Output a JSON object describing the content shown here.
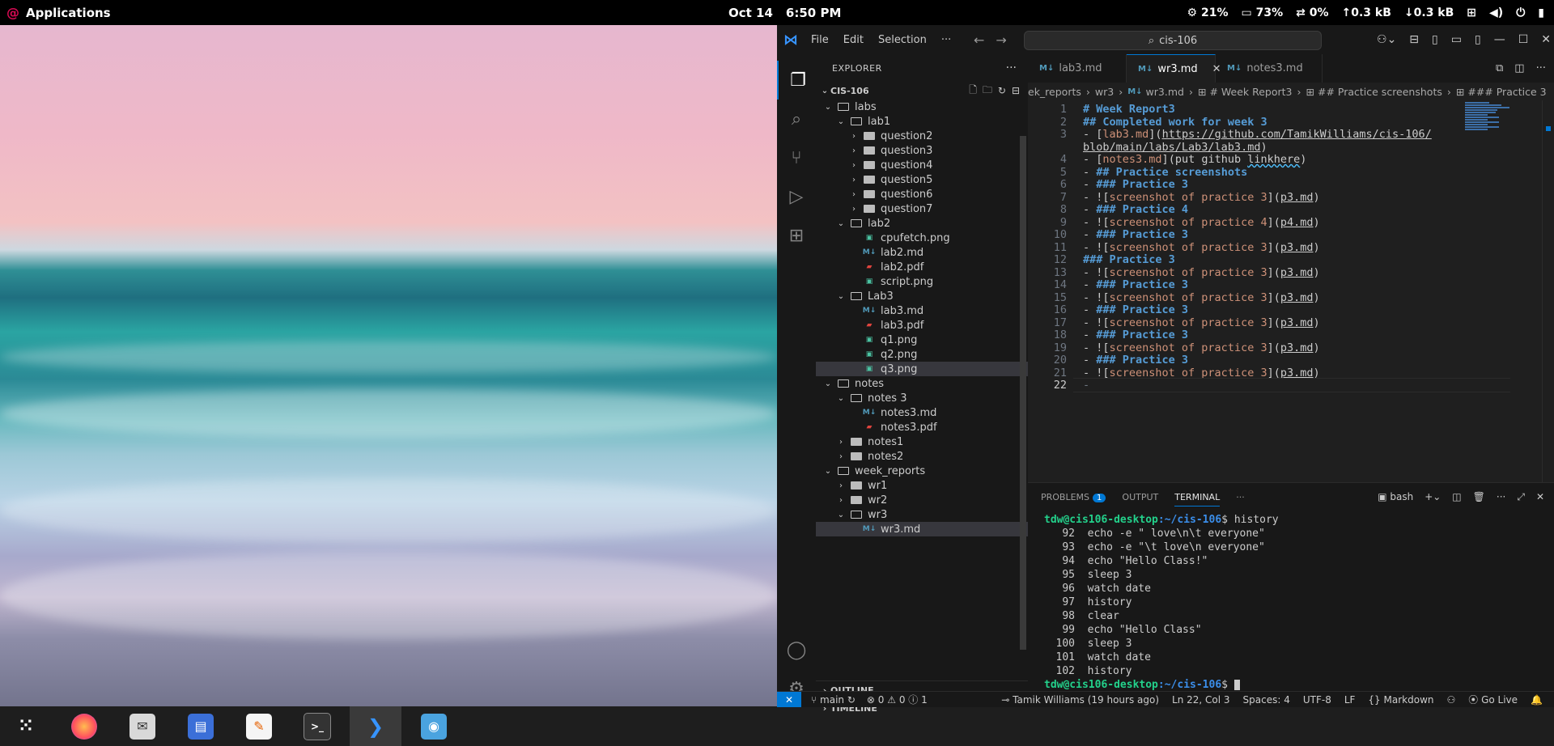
{
  "topbar": {
    "apps_label": "Applications",
    "date": "Oct 14",
    "time": "6:50 PM",
    "cpu": "21%",
    "mem": "73%",
    "swap": "0%",
    "net_up": "↑0.3 kB",
    "net_down": "↓0.3 kB"
  },
  "vscode": {
    "menus": [
      "File",
      "Edit",
      "Selection",
      "···"
    ],
    "search": "cis-106",
    "explorer_title": "EXPLORER",
    "root_folder": "CIS-106",
    "tree": [
      {
        "label": "labs",
        "indent": 1,
        "kind": "folder",
        "open": true
      },
      {
        "label": "lab1",
        "indent": 2,
        "kind": "folder",
        "open": true
      },
      {
        "label": "question2",
        "indent": 3,
        "kind": "folder",
        "open": false
      },
      {
        "label": "question3",
        "indent": 3,
        "kind": "folder",
        "open": false
      },
      {
        "label": "question4",
        "indent": 3,
        "kind": "folder",
        "open": false
      },
      {
        "label": "question5",
        "indent": 3,
        "kind": "folder",
        "open": false
      },
      {
        "label": "question6",
        "indent": 3,
        "kind": "folder",
        "open": false
      },
      {
        "label": "question7",
        "indent": 3,
        "kind": "folder",
        "open": false
      },
      {
        "label": "lab2",
        "indent": 2,
        "kind": "folder",
        "open": true
      },
      {
        "label": "cpufetch.png",
        "indent": 3,
        "kind": "png"
      },
      {
        "label": "lab2.md",
        "indent": 3,
        "kind": "md"
      },
      {
        "label": "lab2.pdf",
        "indent": 3,
        "kind": "pdf"
      },
      {
        "label": "script.png",
        "indent": 3,
        "kind": "png"
      },
      {
        "label": "Lab3",
        "indent": 2,
        "kind": "folder",
        "open": true
      },
      {
        "label": "lab3.md",
        "indent": 3,
        "kind": "md"
      },
      {
        "label": "lab3.pdf",
        "indent": 3,
        "kind": "pdf"
      },
      {
        "label": "q1.png",
        "indent": 3,
        "kind": "png"
      },
      {
        "label": "q2.png",
        "indent": 3,
        "kind": "png"
      },
      {
        "label": "q3.png",
        "indent": 3,
        "kind": "png",
        "hover": true
      },
      {
        "label": "notes",
        "indent": 1,
        "kind": "folder",
        "open": true
      },
      {
        "label": "notes 3",
        "indent": 2,
        "kind": "folder",
        "open": true
      },
      {
        "label": "notes3.md",
        "indent": 3,
        "kind": "md"
      },
      {
        "label": "notes3.pdf",
        "indent": 3,
        "kind": "pdf"
      },
      {
        "label": "notes1",
        "indent": 2,
        "kind": "folder",
        "open": false
      },
      {
        "label": "notes2",
        "indent": 2,
        "kind": "folder",
        "open": false
      },
      {
        "label": "week_reports",
        "indent": 1,
        "kind": "folder",
        "open": true
      },
      {
        "label": "wr1",
        "indent": 2,
        "kind": "folder",
        "open": false
      },
      {
        "label": "wr2",
        "indent": 2,
        "kind": "folder",
        "open": false
      },
      {
        "label": "wr3",
        "indent": 2,
        "kind": "folder",
        "open": true
      },
      {
        "label": "wr3.md",
        "indent": 3,
        "kind": "md",
        "selected": true
      }
    ],
    "outline_label": "OUTLINE",
    "timeline_label": "TIMELINE",
    "tabs": [
      {
        "label": "lab3.md",
        "active": false
      },
      {
        "label": "wr3.md",
        "active": true
      },
      {
        "label": "notes3.md",
        "active": false
      }
    ],
    "breadcrumb": [
      "ek_reports",
      "wr3",
      "wr3.md",
      "# Week Report3",
      "## Practice screenshots",
      "### Practice 3"
    ],
    "code_lines": [
      {
        "n": "1",
        "kind": "h",
        "text": "# Week Report3"
      },
      {
        "n": "2",
        "kind": "h",
        "text": "## Completed work for week 3"
      },
      {
        "n": "3",
        "kind": "link",
        "label": "lab3.md",
        "url": "https://github.com/TamikWilliams/cis-106/",
        "url2": "blob/main/labs/Lab3/lab3.md"
      },
      {
        "n": "4",
        "kind": "link2",
        "label": "notes3.md",
        "pre": "(put github ",
        "sq": "linkhere",
        "post": ")"
      },
      {
        "n": "5",
        "kind": "lh",
        "text": "## Practice screenshots"
      },
      {
        "n": "6",
        "kind": "lh",
        "text": "### Practice 3"
      },
      {
        "n": "7",
        "kind": "img",
        "alt": "screenshot of practice 3",
        "src": "p3.md"
      },
      {
        "n": "8",
        "kind": "lh",
        "text": "### Practice 4"
      },
      {
        "n": "9",
        "kind": "img",
        "alt": "screenshot of practice 4",
        "src": "p4.md"
      },
      {
        "n": "10",
        "kind": "lh",
        "text": "### Practice 3"
      },
      {
        "n": "11",
        "kind": "img",
        "alt": "screenshot of practice 3",
        "src": "p3.md"
      },
      {
        "n": "12",
        "kind": "h",
        "text": "### Practice 3"
      },
      {
        "n": "13",
        "kind": "img",
        "alt": "screenshot of practice 3",
        "src": "p3.md"
      },
      {
        "n": "14",
        "kind": "lh",
        "text": "### Practice 3"
      },
      {
        "n": "15",
        "kind": "img",
        "alt": "screenshot of practice 3",
        "src": "p3.md"
      },
      {
        "n": "16",
        "kind": "lh",
        "text": "### Practice 3"
      },
      {
        "n": "17",
        "kind": "img",
        "alt": "screenshot of practice 3",
        "src": "p3.md"
      },
      {
        "n": "18",
        "kind": "lh",
        "text": "### Practice 3"
      },
      {
        "n": "19",
        "kind": "img",
        "alt": "screenshot of practice 3",
        "src": "p3.md"
      },
      {
        "n": "20",
        "kind": "lh",
        "text": "### Practice 3"
      },
      {
        "n": "21",
        "kind": "img",
        "alt": "screenshot of practice 3",
        "src": "p3.md"
      },
      {
        "n": "22",
        "kind": "dash",
        "text": "-"
      }
    ],
    "panel": {
      "problems_label": "PROBLEMS",
      "problems_count": "1",
      "output_label": "OUTPUT",
      "terminal_label": "TERMINAL",
      "shell": "bash",
      "prompt_user": "tdw@cis106-desktop",
      "prompt_path": ":~/cis-106",
      "first_command": "history",
      "history": [
        {
          "n": "92",
          "cmd": "echo -e \" love\\n\\t everyone\""
        },
        {
          "n": "93",
          "cmd": "echo -e \"\\t love\\n everyone\""
        },
        {
          "n": "94",
          "cmd": "echo \"Hello Class!\""
        },
        {
          "n": "95",
          "cmd": "sleep 3"
        },
        {
          "n": "96",
          "cmd": "watch date"
        },
        {
          "n": "97",
          "cmd": "history"
        },
        {
          "n": "98",
          "cmd": "clear"
        },
        {
          "n": "99",
          "cmd": "echo \"Hello Class\""
        },
        {
          "n": "100",
          "cmd": "sleep 3"
        },
        {
          "n": "101",
          "cmd": "watch date"
        },
        {
          "n": "102",
          "cmd": "history"
        }
      ]
    },
    "status": {
      "branch": "main",
      "problems": "0",
      "warnings": "0",
      "info": "1",
      "blame": "Tamik Williams (19 hours ago)",
      "position": "Ln 22, Col 3",
      "spaces": "Spaces: 4",
      "encoding": "UTF-8",
      "eol": "LF",
      "language": "Markdown",
      "golive": "Go Live"
    }
  },
  "colors": {
    "accent": "#0078d4",
    "heading": "#569cd6",
    "link_label": "#ce9178",
    "prompt": "#23d18b"
  }
}
